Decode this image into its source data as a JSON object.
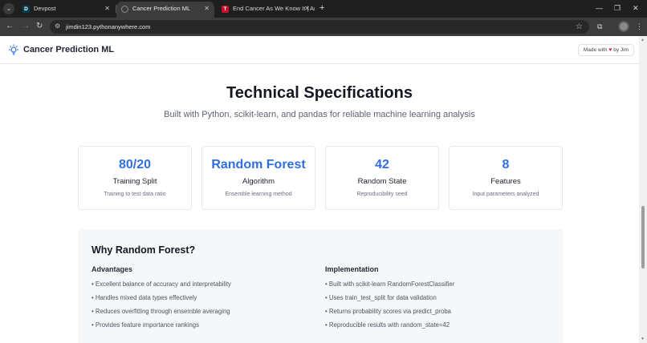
{
  "browser": {
    "tabs": [
      {
        "title": "Devpost",
        "favicon": "D",
        "favicon_color": "#003e54",
        "active": false
      },
      {
        "title": "Cancer Prediction ML",
        "favicon": "◌",
        "favicon_color": "#5a5a5a",
        "active": true
      },
      {
        "title": "End Cancer As We Know It | Am",
        "favicon": "T",
        "favicon_color": "#c8102e",
        "active": false
      }
    ],
    "url": "jimdin123.pythonanywhere.com"
  },
  "header": {
    "brand": "Cancer Prediction ML",
    "badge_prefix": "Made with",
    "badge_suffix": "by Jim"
  },
  "specs": {
    "title": "Technical Specifications",
    "subtitle": "Built with Python, scikit-learn, and pandas for reliable machine learning analysis",
    "cards": [
      {
        "value": "80/20",
        "label": "Training Split",
        "desc": "Training to test data ratio"
      },
      {
        "value": "Random Forest",
        "label": "Algorithm",
        "desc": "Ensemble learning method"
      },
      {
        "value": "42",
        "label": "Random State",
        "desc": "Reproducibility seed"
      },
      {
        "value": "8",
        "label": "Features",
        "desc": "Input parameters analyzed"
      }
    ]
  },
  "why": {
    "title": "Why Random Forest?",
    "advantages": {
      "heading": "Advantages",
      "items": [
        "• Excellent balance of accuracy and interpretability",
        "• Handles mixed data types effectively",
        "• Reduces overfitting through ensemble averaging",
        "• Provides feature importance rankings"
      ]
    },
    "implementation": {
      "heading": "Implementation",
      "items": [
        "• Built with scikit-learn RandomForestClassifier",
        "• Uses train_test_split for data validation",
        "• Returns probability scores via predict_proba",
        "• Reproducible results with random_state=42"
      ]
    }
  },
  "colors": {
    "accent": "#2f6fde",
    "heart": "#e0245e"
  }
}
